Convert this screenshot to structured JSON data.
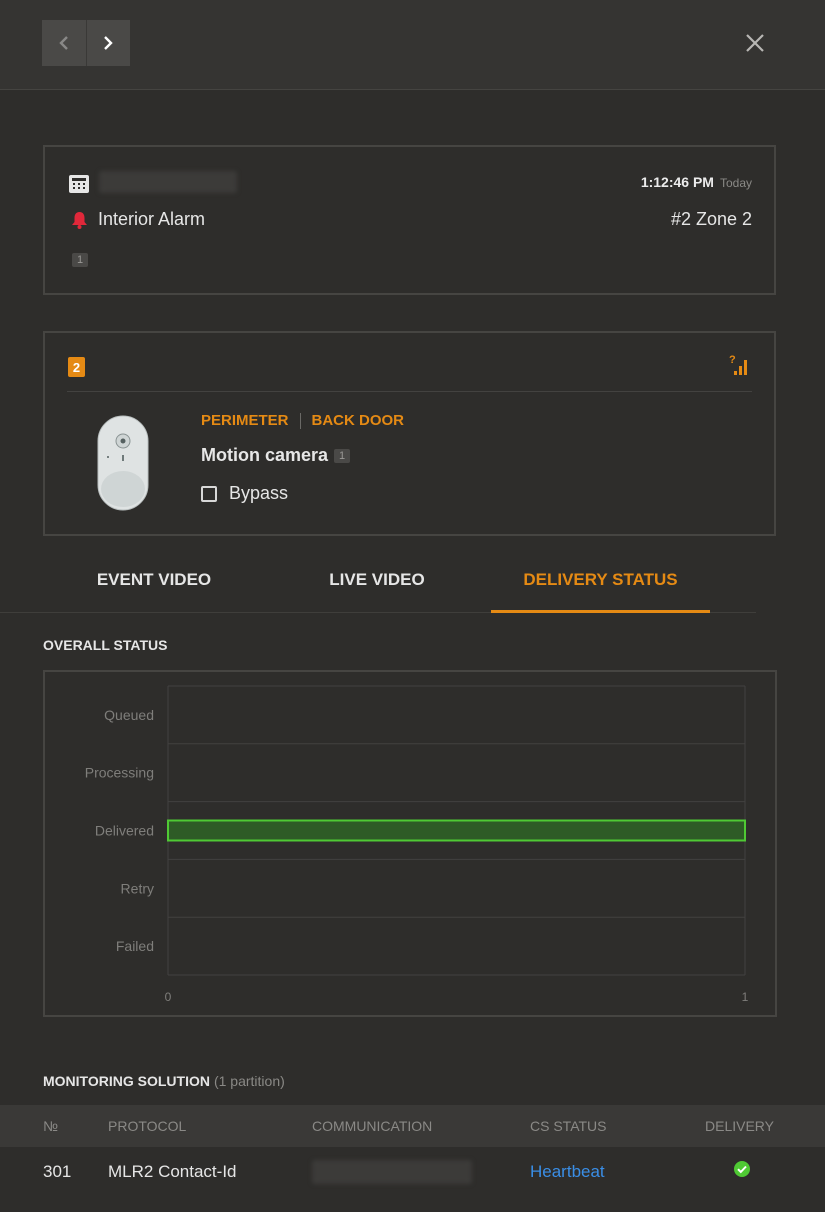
{
  "header": {
    "prev_label": "Previous",
    "next_label": "Next",
    "close_label": "Close"
  },
  "event": {
    "device_name_hidden": "",
    "time": "1:12:46 PM",
    "day": "Today",
    "alarm_type": "Interior Alarm",
    "zone": "#2 Zone 2",
    "partition_badge": "1"
  },
  "zone_card": {
    "zone_number": "2",
    "signal_icon": "signal-unknown-icon",
    "groups": [
      "PERIMETER",
      "BACK DOOR"
    ],
    "device_name": "Motion camera",
    "device_badge": "1",
    "bypass_label": "Bypass",
    "bypass_checked": false
  },
  "tabs": [
    {
      "label": "EVENT VIDEO",
      "active": false
    },
    {
      "label": "LIVE VIDEO",
      "active": false
    },
    {
      "label": "DELIVERY STATUS",
      "active": true
    }
  ],
  "overall_status": {
    "title": "OVERALL STATUS"
  },
  "chart_data": {
    "type": "bar",
    "orientation": "horizontal",
    "categories": [
      "Queued",
      "Processing",
      "Delivered",
      "Retry",
      "Failed"
    ],
    "values": [
      0,
      0,
      1,
      0,
      0
    ],
    "xlim": [
      0,
      1
    ],
    "x_ticks": [
      "0",
      "1"
    ],
    "bar_color": "#2e5b26",
    "bar_border": "#4fc934",
    "grid": true
  },
  "monitoring": {
    "title": "MONITORING SOLUTION",
    "subtitle": "(1 partition)",
    "columns": [
      "№",
      "PROTOCOL",
      "COMMUNICATION",
      "CS STATUS",
      "DELIVERY"
    ],
    "rows": [
      {
        "number": "301",
        "protocol": "MLR2 Contact-Id",
        "communication": "",
        "cs_status": "Heartbeat",
        "delivery_icon": "check-circle-icon"
      }
    ]
  },
  "colors": {
    "accent": "#e58a14",
    "alarm": "#e0283a",
    "success": "#4fc934",
    "link": "#3a8ee6"
  }
}
